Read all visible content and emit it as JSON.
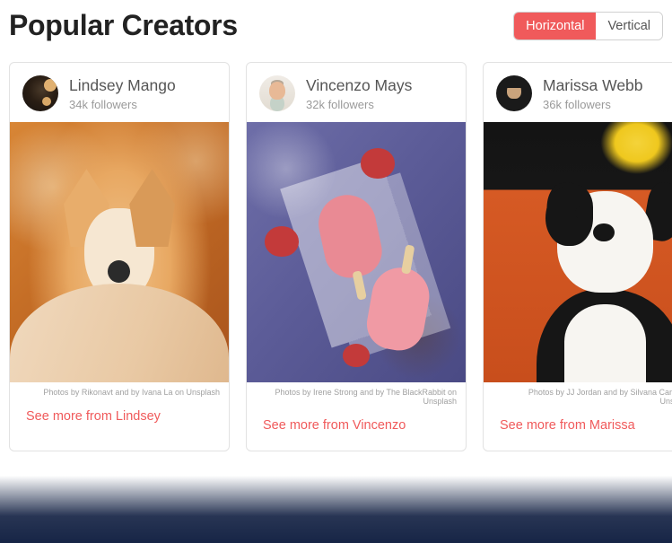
{
  "header": {
    "title": "Popular Creators"
  },
  "toggle": {
    "horizontal": "Horizontal",
    "vertical": "Vertical"
  },
  "creators": [
    {
      "name": "Lindsey Mango",
      "followers": "34k followers",
      "caption": "Photos by Rikonavt and by Ivana La on Unsplash",
      "link": "See more from Lindsey"
    },
    {
      "name": "Vincenzo Mays",
      "followers": "32k followers",
      "caption": "Photos by Irene Strong and by The BlackRabbit on Unsplash",
      "link": "See more from Vincenzo"
    },
    {
      "name": "Marissa Webb",
      "followers": "36k followers",
      "caption": "Photos by JJ Jordan and by Silvana Carlos on Unsplash",
      "link": "See more from Marissa"
    }
  ]
}
